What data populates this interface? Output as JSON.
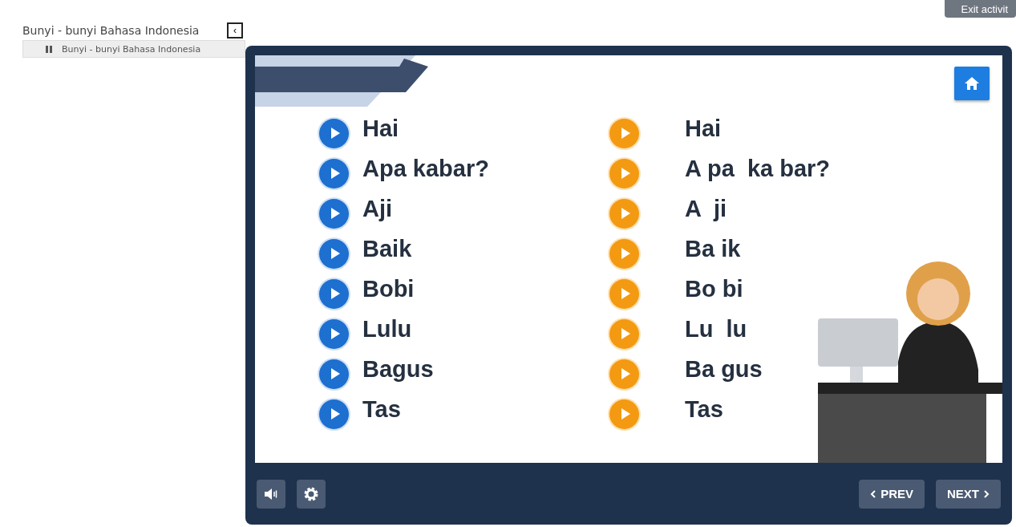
{
  "sidebar": {
    "title": "Bunyi - bunyi Bahasa Indonesia",
    "collapse_icon": "‹",
    "item": {
      "label": "Bunyi - bunyi Bahasa Indonesia",
      "paused": true
    }
  },
  "exit_button": "Exit activit",
  "slide": {
    "words": [
      {
        "text": "Hai",
        "syllables": "Hai"
      },
      {
        "text": "Apa kabar?",
        "syllables": "A pa  ka bar?"
      },
      {
        "text": "Aji",
        "syllables": "A  ji"
      },
      {
        "text": "Baik",
        "syllables": "Ba ik"
      },
      {
        "text": "Bobi",
        "syllables": "Bo bi"
      },
      {
        "text": "Lulu",
        "syllables": "Lu  lu"
      },
      {
        "text": "Bagus",
        "syllables": "Ba gus"
      },
      {
        "text": "Tas",
        "syllables": "Tas"
      }
    ]
  },
  "controls": {
    "prev": "PREV",
    "next": "NEXT"
  }
}
